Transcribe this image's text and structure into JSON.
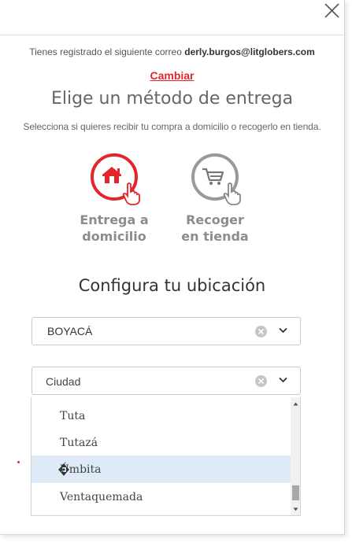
{
  "header": {
    "close_icon": "close-icon",
    "email_prefix": "Tienes registrado el siguiente correo",
    "email": "derly.burgos@litglobers.com",
    "change_link": "Cambiar"
  },
  "delivery": {
    "title": "Elige un método de entrega",
    "subtitle": "Selecciona si quieres recibir tu compra a domicilio o recogerlo en tienda.",
    "options": [
      {
        "line1": "Entrega a",
        "line2": "domicilio",
        "icon": "home-tap-icon",
        "selected": true,
        "color": "#e3262b"
      },
      {
        "line1": "Recoger",
        "line2": "en tienda",
        "icon": "cart-tap-icon",
        "selected": false,
        "color": "#999999"
      }
    ]
  },
  "location": {
    "title": "Configura tu ubicación",
    "department": {
      "value": "BOYACÁ"
    },
    "city": {
      "placeholder": "Ciudad",
      "value": ""
    },
    "city_options": [
      "Tuta",
      "Tutazá",
      "Úmbita",
      "Ventaquemada"
    ],
    "highlighted_option": "Úmbita"
  },
  "colors": {
    "accent": "#e3262b",
    "highlight": "#deebf7",
    "muted_text": "#8c8c8c"
  }
}
